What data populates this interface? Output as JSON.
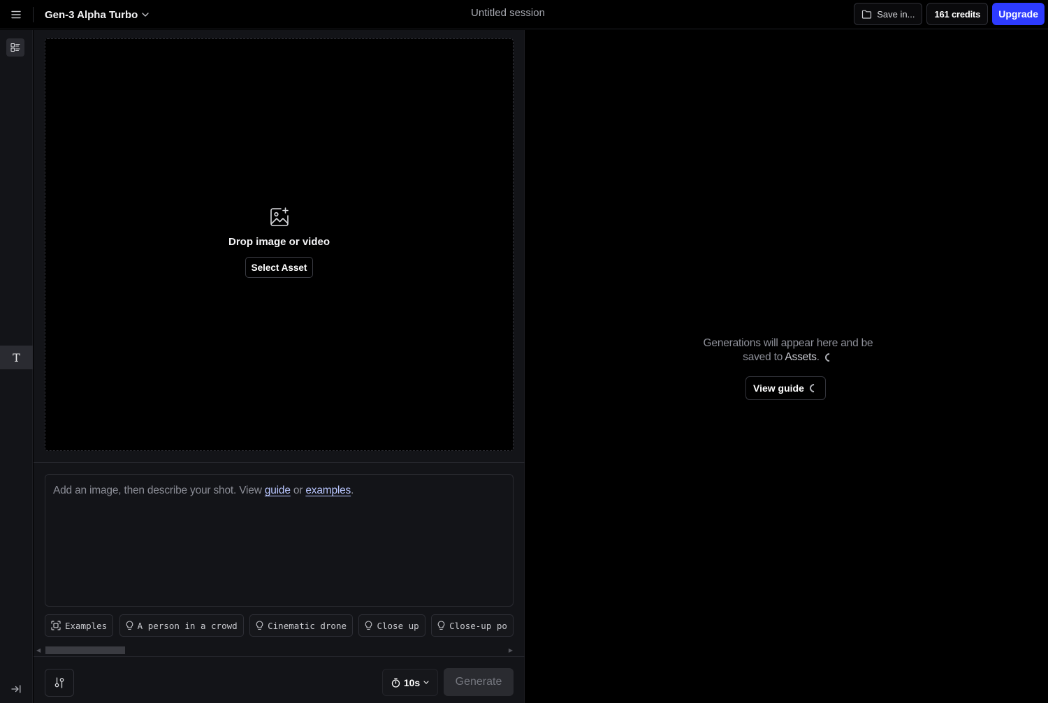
{
  "header": {
    "menu_icon": "hamburger-icon",
    "model_name": "Gen-3 Alpha Turbo",
    "session_title": "Untitled session",
    "save_label": "Save in...",
    "credits_label": "161 credits",
    "upgrade_label": "Upgrade",
    "colors": {
      "upgrade_bg": "#2d3bff",
      "background": "#000000"
    }
  },
  "rail": {
    "toggle_icon": "list-layout-icon",
    "text_tool_label": "T",
    "collapse_icon": "arrow-to-right-icon"
  },
  "dropzone": {
    "icon": "image-add-icon",
    "label": "Drop image or video",
    "select_button": "Select Asset"
  },
  "prompt": {
    "placeholder_prefix": "Add an image, then describe your shot. View ",
    "guide_link": "guide",
    "or_text": " or ",
    "examples_link": "examples",
    "suffix": "."
  },
  "chips": [
    {
      "label": "Examples",
      "icon": "frame-icon"
    },
    {
      "label": "A person in a crowd",
      "icon": "lightbulb-icon"
    },
    {
      "label": "Cinematic drone",
      "icon": "lightbulb-icon"
    },
    {
      "label": "Close up",
      "icon": "lightbulb-icon"
    },
    {
      "label": "Close-up po",
      "icon": "lightbulb-icon"
    }
  ],
  "footer": {
    "settings_icon": "sliders-icon",
    "duration": "10s",
    "generate_label": "Generate"
  },
  "results": {
    "line1": "Generations will appear here and be",
    "line2_prefix": "saved to ",
    "assets_link": "Assets",
    "line2_suffix": ".",
    "view_guide": "View guide"
  }
}
